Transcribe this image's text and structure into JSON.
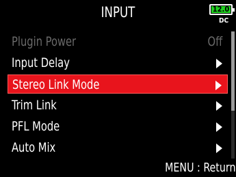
{
  "header": {
    "title": "INPUT",
    "battery_value": "12.0",
    "power_source": "DC",
    "battery_color": "#20d020"
  },
  "menu": {
    "items": [
      {
        "label": "Plugin Power",
        "value": "Off",
        "state": "disabled"
      },
      {
        "label": "Input Delay",
        "icon": "right-arrow-icon"
      },
      {
        "label": "Stereo Link Mode",
        "icon": "right-arrow-icon",
        "state": "selected"
      },
      {
        "label": "Trim Link",
        "icon": "right-arrow-icon"
      },
      {
        "label": "PFL Mode",
        "icon": "right-arrow-icon"
      },
      {
        "label": "Auto Mix",
        "icon": "right-arrow-icon"
      }
    ],
    "highlight_color": "#e8141c"
  },
  "footer": {
    "hint": "MENU : Return"
  }
}
